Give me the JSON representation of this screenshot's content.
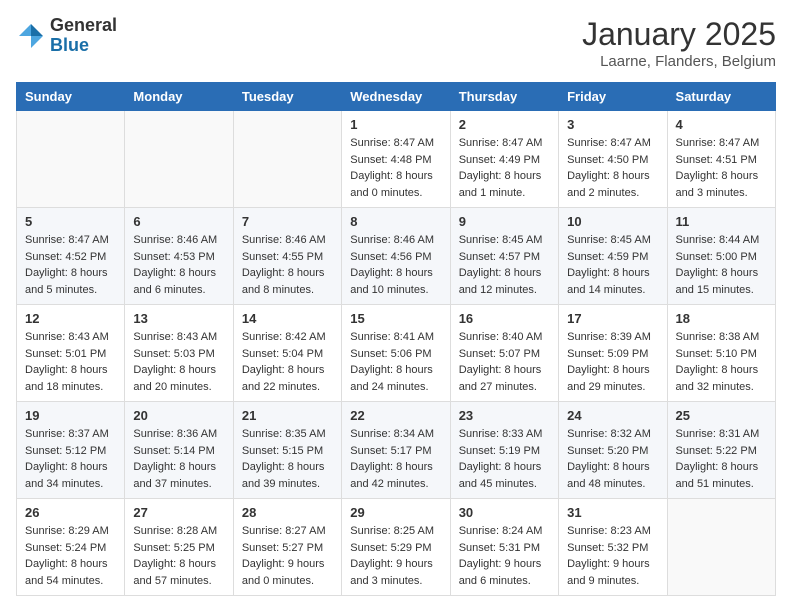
{
  "header": {
    "logo_general": "General",
    "logo_blue": "Blue",
    "month_title": "January 2025",
    "location": "Laarne, Flanders, Belgium"
  },
  "weekdays": [
    "Sunday",
    "Monday",
    "Tuesday",
    "Wednesday",
    "Thursday",
    "Friday",
    "Saturday"
  ],
  "weeks": [
    [
      {
        "day": "",
        "info": ""
      },
      {
        "day": "",
        "info": ""
      },
      {
        "day": "",
        "info": ""
      },
      {
        "day": "1",
        "info": "Sunrise: 8:47 AM\nSunset: 4:48 PM\nDaylight: 8 hours\nand 0 minutes."
      },
      {
        "day": "2",
        "info": "Sunrise: 8:47 AM\nSunset: 4:49 PM\nDaylight: 8 hours\nand 1 minute."
      },
      {
        "day": "3",
        "info": "Sunrise: 8:47 AM\nSunset: 4:50 PM\nDaylight: 8 hours\nand 2 minutes."
      },
      {
        "day": "4",
        "info": "Sunrise: 8:47 AM\nSunset: 4:51 PM\nDaylight: 8 hours\nand 3 minutes."
      }
    ],
    [
      {
        "day": "5",
        "info": "Sunrise: 8:47 AM\nSunset: 4:52 PM\nDaylight: 8 hours\nand 5 minutes."
      },
      {
        "day": "6",
        "info": "Sunrise: 8:46 AM\nSunset: 4:53 PM\nDaylight: 8 hours\nand 6 minutes."
      },
      {
        "day": "7",
        "info": "Sunrise: 8:46 AM\nSunset: 4:55 PM\nDaylight: 8 hours\nand 8 minutes."
      },
      {
        "day": "8",
        "info": "Sunrise: 8:46 AM\nSunset: 4:56 PM\nDaylight: 8 hours\nand 10 minutes."
      },
      {
        "day": "9",
        "info": "Sunrise: 8:45 AM\nSunset: 4:57 PM\nDaylight: 8 hours\nand 12 minutes."
      },
      {
        "day": "10",
        "info": "Sunrise: 8:45 AM\nSunset: 4:59 PM\nDaylight: 8 hours\nand 14 minutes."
      },
      {
        "day": "11",
        "info": "Sunrise: 8:44 AM\nSunset: 5:00 PM\nDaylight: 8 hours\nand 15 minutes."
      }
    ],
    [
      {
        "day": "12",
        "info": "Sunrise: 8:43 AM\nSunset: 5:01 PM\nDaylight: 8 hours\nand 18 minutes."
      },
      {
        "day": "13",
        "info": "Sunrise: 8:43 AM\nSunset: 5:03 PM\nDaylight: 8 hours\nand 20 minutes."
      },
      {
        "day": "14",
        "info": "Sunrise: 8:42 AM\nSunset: 5:04 PM\nDaylight: 8 hours\nand 22 minutes."
      },
      {
        "day": "15",
        "info": "Sunrise: 8:41 AM\nSunset: 5:06 PM\nDaylight: 8 hours\nand 24 minutes."
      },
      {
        "day": "16",
        "info": "Sunrise: 8:40 AM\nSunset: 5:07 PM\nDaylight: 8 hours\nand 27 minutes."
      },
      {
        "day": "17",
        "info": "Sunrise: 8:39 AM\nSunset: 5:09 PM\nDaylight: 8 hours\nand 29 minutes."
      },
      {
        "day": "18",
        "info": "Sunrise: 8:38 AM\nSunset: 5:10 PM\nDaylight: 8 hours\nand 32 minutes."
      }
    ],
    [
      {
        "day": "19",
        "info": "Sunrise: 8:37 AM\nSunset: 5:12 PM\nDaylight: 8 hours\nand 34 minutes."
      },
      {
        "day": "20",
        "info": "Sunrise: 8:36 AM\nSunset: 5:14 PM\nDaylight: 8 hours\nand 37 minutes."
      },
      {
        "day": "21",
        "info": "Sunrise: 8:35 AM\nSunset: 5:15 PM\nDaylight: 8 hours\nand 39 minutes."
      },
      {
        "day": "22",
        "info": "Sunrise: 8:34 AM\nSunset: 5:17 PM\nDaylight: 8 hours\nand 42 minutes."
      },
      {
        "day": "23",
        "info": "Sunrise: 8:33 AM\nSunset: 5:19 PM\nDaylight: 8 hours\nand 45 minutes."
      },
      {
        "day": "24",
        "info": "Sunrise: 8:32 AM\nSunset: 5:20 PM\nDaylight: 8 hours\nand 48 minutes."
      },
      {
        "day": "25",
        "info": "Sunrise: 8:31 AM\nSunset: 5:22 PM\nDaylight: 8 hours\nand 51 minutes."
      }
    ],
    [
      {
        "day": "26",
        "info": "Sunrise: 8:29 AM\nSunset: 5:24 PM\nDaylight: 8 hours\nand 54 minutes."
      },
      {
        "day": "27",
        "info": "Sunrise: 8:28 AM\nSunset: 5:25 PM\nDaylight: 8 hours\nand 57 minutes."
      },
      {
        "day": "28",
        "info": "Sunrise: 8:27 AM\nSunset: 5:27 PM\nDaylight: 9 hours\nand 0 minutes."
      },
      {
        "day": "29",
        "info": "Sunrise: 8:25 AM\nSunset: 5:29 PM\nDaylight: 9 hours\nand 3 minutes."
      },
      {
        "day": "30",
        "info": "Sunrise: 8:24 AM\nSunset: 5:31 PM\nDaylight: 9 hours\nand 6 minutes."
      },
      {
        "day": "31",
        "info": "Sunrise: 8:23 AM\nSunset: 5:32 PM\nDaylight: 9 hours\nand 9 minutes."
      },
      {
        "day": "",
        "info": ""
      }
    ]
  ]
}
